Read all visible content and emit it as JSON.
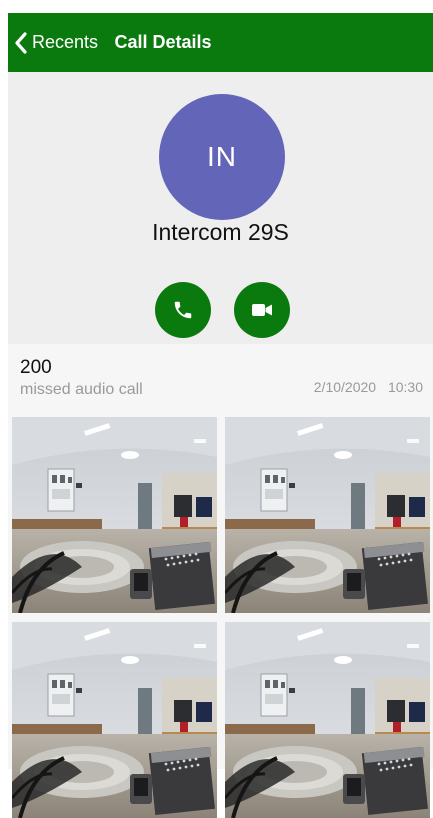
{
  "header": {
    "back_label": "Recents",
    "title": "Call Details",
    "color": "#0b7a0e"
  },
  "contact": {
    "initials": "IN",
    "name": "Intercom 29S",
    "avatar_color": "#6366b8"
  },
  "actions": {
    "audio_icon": "phone-icon",
    "video_icon": "video-camera-icon"
  },
  "call_entry": {
    "number": "200",
    "type": "missed audio call",
    "date": "2/10/2020",
    "time": "10:30"
  },
  "snapshots": [
    {
      "icon": "camera-snapshot"
    },
    {
      "icon": "camera-snapshot"
    },
    {
      "icon": "camera-snapshot"
    },
    {
      "icon": "camera-snapshot"
    }
  ]
}
